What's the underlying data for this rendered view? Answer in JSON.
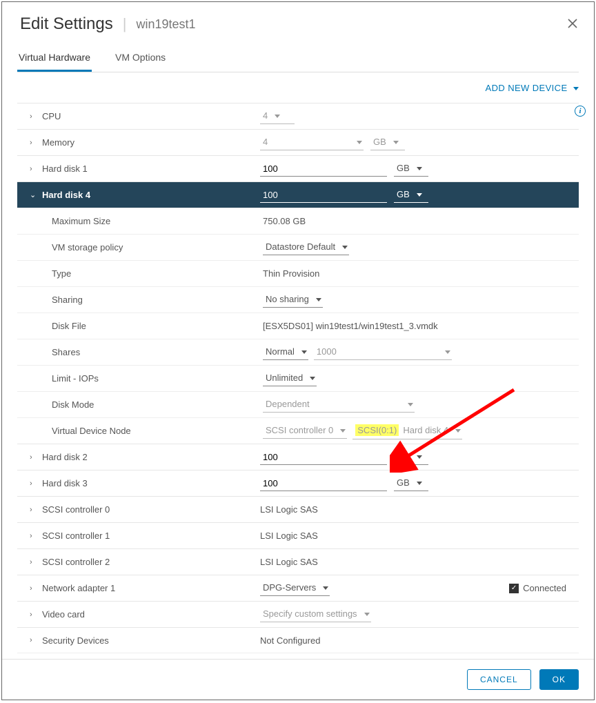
{
  "header": {
    "title": "Edit Settings",
    "subtitle": "win19test1"
  },
  "tabs": {
    "hardware": "Virtual Hardware",
    "options": "VM Options"
  },
  "actions": {
    "add_device": "ADD NEW DEVICE",
    "cancel": "CANCEL",
    "ok": "OK"
  },
  "rows": {
    "cpu": {
      "label": "CPU",
      "value": "4"
    },
    "memory": {
      "label": "Memory",
      "value": "4",
      "unit": "GB"
    },
    "hd1": {
      "label": "Hard disk 1",
      "value": "100",
      "unit": "GB"
    },
    "hd4": {
      "label": "Hard disk 4",
      "value": "100",
      "unit": "GB",
      "max_size_label": "Maximum Size",
      "max_size": "750.08 GB",
      "policy_label": "VM storage policy",
      "policy": "Datastore Default",
      "type_label": "Type",
      "type": "Thin Provision",
      "sharing_label": "Sharing",
      "sharing": "No sharing",
      "diskfile_label": "Disk File",
      "diskfile": "[ESX5DS01] win19test1/win19test1_3.vmdk",
      "shares_label": "Shares",
      "shares": "Normal",
      "shares_value": "1000",
      "iops_label": "Limit - IOPs",
      "iops": "Unlimited",
      "mode_label": "Disk Mode",
      "mode": "Dependent",
      "vdn_label": "Virtual Device Node",
      "vdn_ctrl": "SCSI controller 0",
      "vdn_scsi": "SCSI(0:1)",
      "vdn_disk": "Hard disk 4"
    },
    "hd2": {
      "label": "Hard disk 2",
      "value": "100",
      "unit": "GB"
    },
    "hd3": {
      "label": "Hard disk 3",
      "value": "100",
      "unit": "GB"
    },
    "scsi0": {
      "label": "SCSI controller 0",
      "value": "LSI Logic SAS"
    },
    "scsi1": {
      "label": "SCSI controller 1",
      "value": "LSI Logic SAS"
    },
    "scsi2": {
      "label": "SCSI controller 2",
      "value": "LSI Logic SAS"
    },
    "net1": {
      "label": "Network adapter 1",
      "value": "DPG-Servers",
      "connected": "Connected"
    },
    "video": {
      "label": "Video card",
      "value": "Specify custom settings"
    },
    "security": {
      "label": "Security Devices",
      "value": "Not Configured"
    }
  }
}
